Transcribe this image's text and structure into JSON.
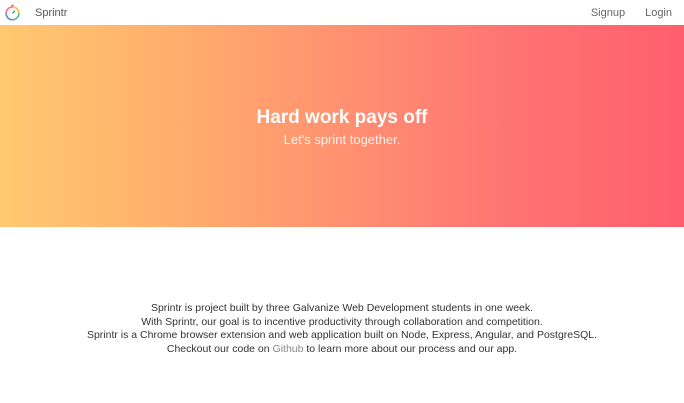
{
  "nav": {
    "brand": "Sprintr",
    "logo_icon": "stopwatch-logo-icon",
    "links": [
      "Signup",
      "Login"
    ]
  },
  "hero": {
    "title": "Hard work pays off",
    "subtitle": "Let's sprint together.",
    "gradient_start": "#ffc971",
    "gradient_end": "#ff5f6d"
  },
  "about": {
    "line1": "Sprintr is project built by three Galvanize Web Development students in one week.",
    "line2": "With Sprintr, our goal is to incentive productivity through collaboration and competition.",
    "line3": "Sprintr is a Chrome browser extension and web application built on Node, Express, Angular, and PostgreSQL.",
    "line4_before": "Checkout our code on ",
    "line4_link": "Github",
    "line4_after": " to learn more about our process and our app."
  }
}
